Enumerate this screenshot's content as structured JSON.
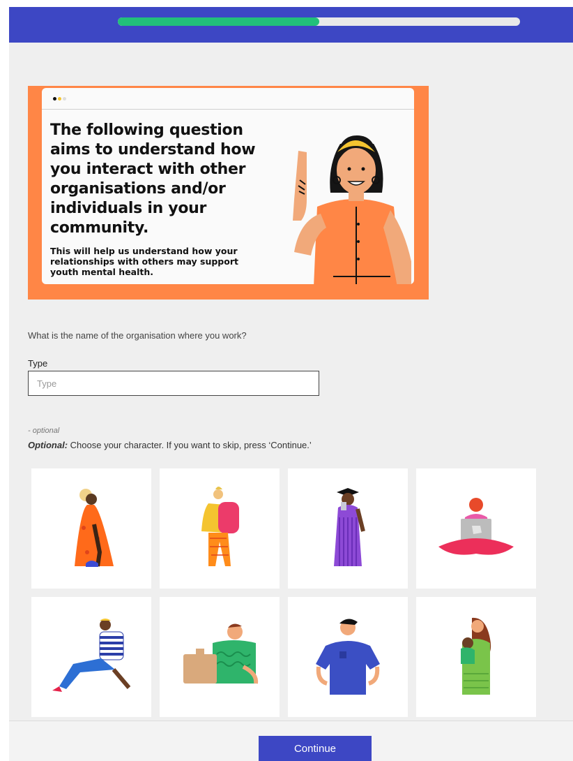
{
  "progress": {
    "fraction": 0.5
  },
  "banner": {
    "title": "The following question aims to understand how you interact with other organisations and/or individuals in your community.",
    "subtitle": "This will help us understand how your relationships with others may support youth mental health."
  },
  "form": {
    "question": "What is the name of the organisation where you work?",
    "field_label": "Type",
    "field_placeholder": "Type",
    "field_value": ""
  },
  "characters": {
    "optional_tag": "- optional",
    "prompt_bold": "Optional:",
    "prompt_rest": " Choose your character. If you want to skip, press ‘Continue.’",
    "items": [
      {
        "icon": "character-woman-orange-dress-icon"
      },
      {
        "icon": "character-backpack-icon"
      },
      {
        "icon": "character-graduate-icon"
      },
      {
        "icon": "character-laptop-icon"
      },
      {
        "icon": "character-sitting-man-icon"
      },
      {
        "icon": "character-man-with-box-icon"
      },
      {
        "icon": "character-man-blue-shirt-icon"
      },
      {
        "icon": "character-woman-with-baby-icon"
      }
    ]
  },
  "footer": {
    "continue_label": "Continue"
  },
  "colors": {
    "header": "#3d47c4",
    "progress": "#22c07a",
    "banner": "#ff8646",
    "button": "#3d47c4"
  }
}
